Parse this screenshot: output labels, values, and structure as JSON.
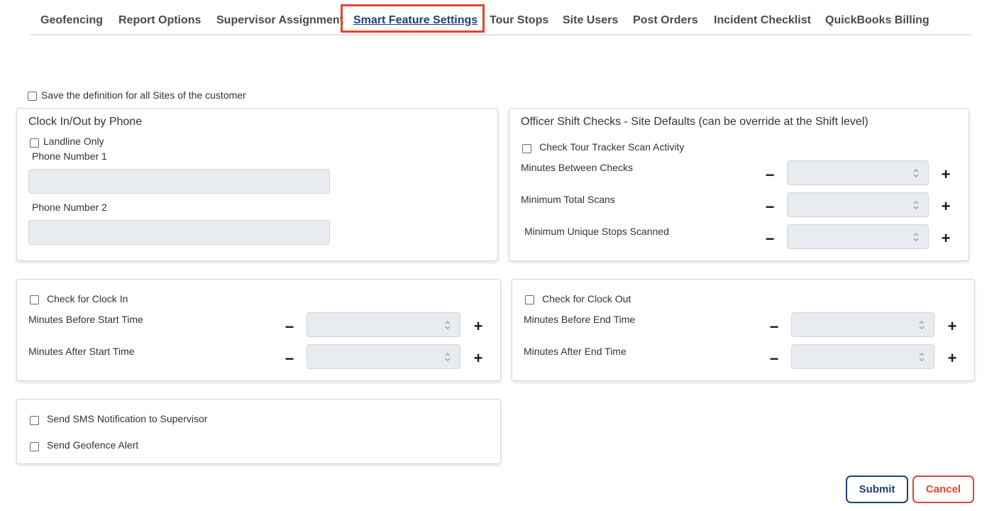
{
  "tabs": [
    {
      "label": "Geofencing"
    },
    {
      "label": "Report Options"
    },
    {
      "label": "Supervisor Assignment"
    },
    {
      "label": "Smart Feature Settings",
      "active": true
    },
    {
      "label": "Tour Stops"
    },
    {
      "label": "Site Users"
    },
    {
      "label": "Post Orders"
    },
    {
      "label": "Incident Checklist"
    },
    {
      "label": "QuickBooks Billing"
    }
  ],
  "save_all_sites": {
    "label": "Save the definition for all Sites of the customer",
    "checked": false
  },
  "clock_phone": {
    "title": "Clock In/Out by Phone",
    "landline_only": {
      "label": "Landline Only",
      "checked": false
    },
    "phone1_label": "Phone Number 1",
    "phone1_value": "",
    "phone2_label": "Phone Number 2",
    "phone2_value": ""
  },
  "officer_checks": {
    "title": "Officer Shift Checks - Site Defaults (can be override at the Shift level)",
    "tour_tracker": {
      "label": "Check Tour Tracker Scan Activity",
      "checked": false
    },
    "minutes_between_label": "Minutes Between Checks",
    "min_total_scans_label": "Minimum Total Scans",
    "min_unique_stops_label": "Minimum Unique Stops Scanned"
  },
  "clock_in": {
    "label": "Check for Clock In",
    "checked": false,
    "before_label": "Minutes Before Start Time",
    "after_label": "Minutes After Start Time"
  },
  "clock_out": {
    "label": "Check for Clock Out",
    "checked": false,
    "before_label": "Minutes Before End Time",
    "after_label": "Minutes After End Time"
  },
  "notifications": {
    "sms_label": "Send SMS Notification to Supervisor",
    "geofence_label": "Send Geofence Alert"
  },
  "stepper": {
    "minus": "−",
    "plus": "+"
  },
  "buttons": {
    "submit": "Submit",
    "cancel": "Cancel"
  },
  "colors": {
    "accent": "#1f3f7a",
    "highlight": "#e4452d",
    "input_bg": "#e8ebef"
  },
  "icons": {
    "spinner": "updown-chevron-icon"
  }
}
